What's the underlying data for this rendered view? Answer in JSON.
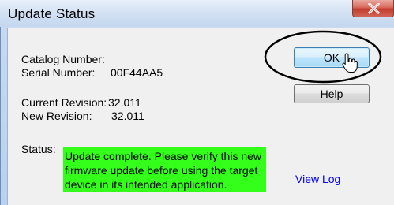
{
  "dialog": {
    "title": "Update Status",
    "catalog_number_label": "Catalog Number:",
    "catalog_number_value": "",
    "serial_number_label": "Serial Number:",
    "serial_number_value": "00F44AA5",
    "current_revision_label": "Current Revision:",
    "current_revision_value": "32.011",
    "new_revision_label": "New Revision:",
    "new_revision_value": "32.011",
    "status_label": "Status:",
    "status_lines": [
      "Update complete. Please verify this new",
      "firmware update before using the target",
      "device in its intended application."
    ],
    "ok_label": "OK",
    "help_label": "Help",
    "view_log_label": "View Log"
  },
  "icons": {
    "close": "close-icon",
    "cursor": "hand-pointer-icon"
  },
  "colors": {
    "status_background": "#33ff1a",
    "link": "#0000ee",
    "close_button": "#c23b2d"
  }
}
